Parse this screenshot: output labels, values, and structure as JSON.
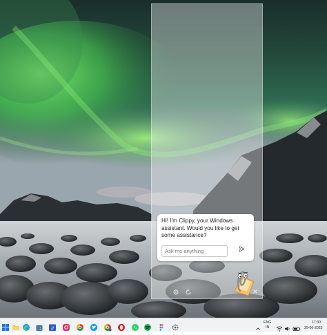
{
  "clippy": {
    "greeting": "Hi! I'm Clippy, your Windows assistant. Would you like to get some assistance?",
    "input_placeholder": "Ask me anything",
    "input_value": ""
  },
  "taskbar": {
    "apps": [
      "windows-start",
      "search",
      "file-explorer",
      "edge",
      "store",
      "calendar",
      "instagram",
      "chrome",
      "twitter",
      "chrome-profile",
      "opera",
      "whatsapp",
      "spotify",
      "figma",
      "settings"
    ]
  },
  "tray": {
    "language": "ENG",
    "region": "IN",
    "time": "17:30",
    "date": "29-06-2023"
  },
  "colors": {
    "aurora_green": "#5ddd5a",
    "taskbar_bg": "#f1f2f4",
    "accent_blue": "#1a73e8"
  }
}
